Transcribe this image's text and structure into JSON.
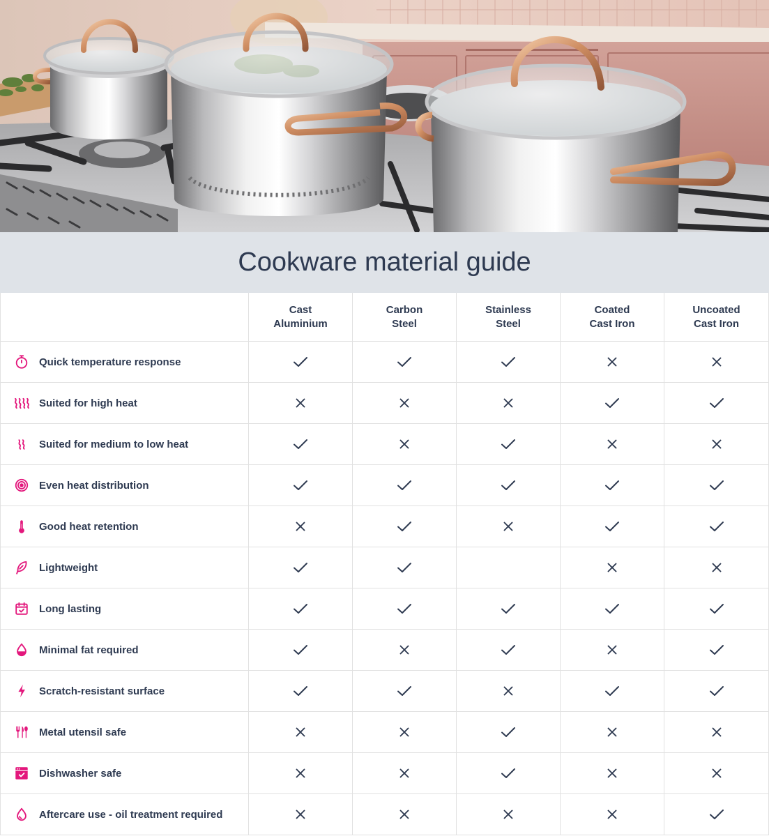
{
  "title": "Cookware material guide",
  "columns": [
    {
      "line1": "Cast",
      "line2": "Aluminium"
    },
    {
      "line1": "Carbon",
      "line2": "Steel"
    },
    {
      "line1": "Stainless",
      "line2": "Steel"
    },
    {
      "line1": "Coated",
      "line2": "Cast Iron"
    },
    {
      "line1": "Uncoated",
      "line2": "Cast Iron"
    }
  ],
  "rows": [
    {
      "icon": "stopwatch-icon",
      "label": "Quick temperature response",
      "values": [
        "check",
        "check",
        "check",
        "cross",
        "cross"
      ]
    },
    {
      "icon": "high-heat-icon",
      "label": "Suited for high heat",
      "values": [
        "cross",
        "cross",
        "cross",
        "check",
        "check"
      ]
    },
    {
      "icon": "medium-heat-icon",
      "label": "Suited for medium to low heat",
      "values": [
        "check",
        "cross",
        "check",
        "cross",
        "cross"
      ]
    },
    {
      "icon": "burner-icon",
      "label": "Even heat distribution",
      "values": [
        "check",
        "check",
        "check",
        "check",
        "check"
      ]
    },
    {
      "icon": "thermometer-icon",
      "label": "Good heat retention",
      "values": [
        "cross",
        "check",
        "cross",
        "check",
        "check"
      ]
    },
    {
      "icon": "feather-icon",
      "label": "Lightweight",
      "values": [
        "check",
        "check",
        "",
        "cross",
        "cross"
      ]
    },
    {
      "icon": "calendar-check-icon",
      "label": "Long lasting",
      "values": [
        "check",
        "check",
        "check",
        "check",
        "check"
      ]
    },
    {
      "icon": "oil-drop-icon",
      "label": "Minimal fat required",
      "values": [
        "check",
        "cross",
        "check",
        "cross",
        "check"
      ]
    },
    {
      "icon": "lightning-icon",
      "label": "Scratch-resistant surface",
      "values": [
        "check",
        "check",
        "cross",
        "check",
        "check"
      ]
    },
    {
      "icon": "utensils-icon",
      "label": "Metal utensil safe",
      "values": [
        "cross",
        "cross",
        "check",
        "cross",
        "cross"
      ]
    },
    {
      "icon": "dishwasher-icon",
      "label": "Dishwasher safe",
      "values": [
        "cross",
        "cross",
        "check",
        "cross",
        "cross"
      ]
    },
    {
      "icon": "drop-icon",
      "label": "Aftercare use - oil treatment required",
      "values": [
        "cross",
        "cross",
        "cross",
        "cross",
        "check"
      ]
    }
  ],
  "colors": {
    "accent": "#e3177c",
    "text": "#2e3a51",
    "mark": "#2e3a51",
    "banner": "#dfe3e8",
    "border": "#e1e1e1"
  }
}
